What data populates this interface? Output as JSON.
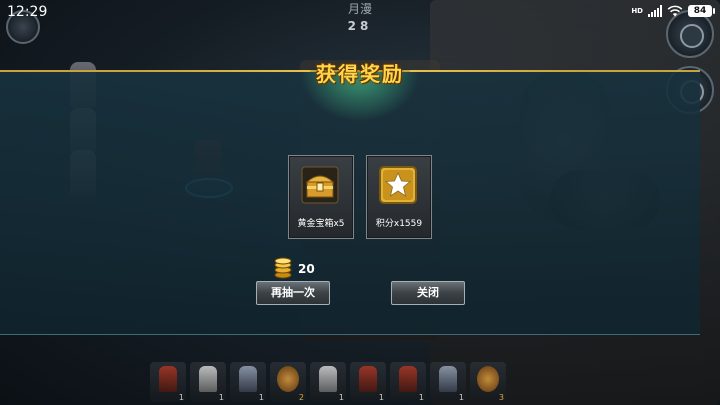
{
  "status_bar": {
    "time": "12:29",
    "network": "HD",
    "battery": "84"
  },
  "top_badge": {
    "label": "月漫",
    "value": "28"
  },
  "dialog": {
    "title": "获得奖励",
    "rewards": [
      {
        "icon": "gold-chest-icon",
        "label": "黄金宝箱x5"
      },
      {
        "icon": "star-points-icon",
        "label": "积分x1559"
      }
    ],
    "cost": {
      "icon": "gold-coin-icon",
      "amount": "20"
    },
    "buttons": {
      "draw_again": "再抽一次",
      "close": "关闭"
    }
  },
  "bottom_tray": {
    "slots": [
      {
        "icon": "red-cavalry-icon",
        "count": "1"
      },
      {
        "icon": "white-horse-icon",
        "count": "1"
      },
      {
        "icon": "knight-icon",
        "count": "1"
      },
      {
        "icon": "shield-icon",
        "count": "2"
      },
      {
        "icon": "white-horse-icon",
        "count": "1"
      },
      {
        "icon": "red-cavalry-icon",
        "count": "1"
      },
      {
        "icon": "red-cavalry-icon",
        "count": "1"
      },
      {
        "icon": "knight-icon",
        "count": "1"
      },
      {
        "icon": "shield-icon",
        "count": "3"
      }
    ]
  },
  "colors": {
    "title_gold": "#ffd54a",
    "panel_bg": "#18323e",
    "accent_line": "#caa33a"
  }
}
